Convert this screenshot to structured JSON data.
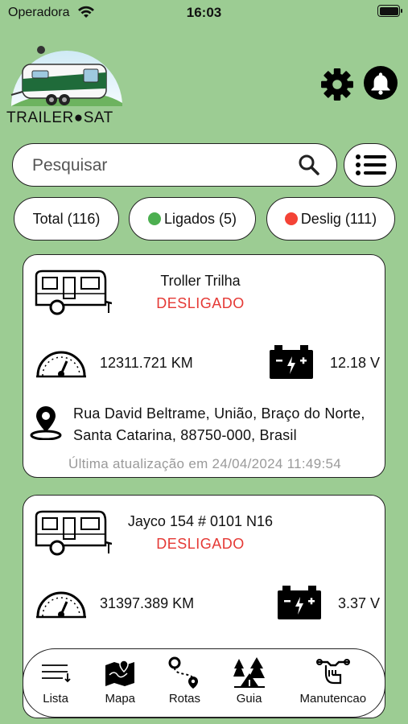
{
  "status_bar": {
    "carrier": "Operadora",
    "time": "16:03"
  },
  "logo": {
    "text": "TRAILER●SAT"
  },
  "search": {
    "placeholder": "Pesquisar",
    "value": ""
  },
  "filters": {
    "total": "Total (116)",
    "on": "Ligados (5)",
    "off": "Deslig (111)",
    "on_color": "#4caf50",
    "off_color": "#f44336"
  },
  "vehicles": [
    {
      "name": "Troller Trilha",
      "state": "DESLIGADO",
      "odometer": "12311.721 KM",
      "voltage": "12.18 V",
      "address": "Rua David Beltrame, União, Braço do Norte, Santa Catarina, 88750-000, Brasil",
      "updated": "Última atualização em 24/04/2024 11:49:54"
    },
    {
      "name": "Jayco 154 # 0101 N16",
      "state": "DESLIGADO",
      "odometer": "31397.389 KM",
      "voltage": "3.37 V",
      "address": "",
      "updated": ""
    }
  ],
  "nav": {
    "list": "Lista",
    "map": "Mapa",
    "routes": "Rotas",
    "guide": "Guia",
    "maintenance": "Manutencao"
  },
  "colors": {
    "background": "#9ccc93",
    "state_off": "#e53935"
  }
}
